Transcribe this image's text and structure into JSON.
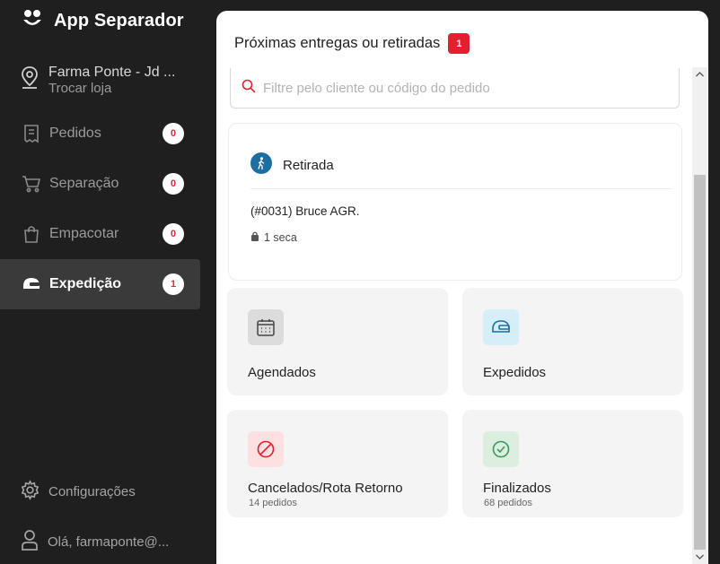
{
  "app": {
    "title": "App Separador"
  },
  "store": {
    "name": "Farma Ponte - Jd ...",
    "switch_label": "Trocar loja"
  },
  "nav": {
    "items": [
      {
        "label": "Pedidos",
        "count": "0"
      },
      {
        "label": "Separação",
        "count": "0"
      },
      {
        "label": "Empacotar",
        "count": "0"
      },
      {
        "label": "Expedição",
        "count": "1",
        "active": true
      }
    ]
  },
  "footer": {
    "settings_label": "Configurações",
    "user_label": "Olá, farmaponte@..."
  },
  "main": {
    "title": "Próximas entregas ou retiradas",
    "count": "1",
    "search_placeholder": "Filtre pelo cliente ou código do pedido",
    "delivery": {
      "type": "Retirada",
      "order": "(#0031) Bruce AGR.",
      "items": "1 seca"
    },
    "tiles": [
      {
        "label": "Agendados",
        "sub": ""
      },
      {
        "label": "Expedidos",
        "sub": ""
      },
      {
        "label": "Cancelados/Rota Retorno",
        "sub": "14 pedidos"
      },
      {
        "label": "Finalizados",
        "sub": "68 pedidos"
      }
    ]
  },
  "colors": {
    "accent_red": "#e2202f",
    "sidebar_bg": "#1f1f1f",
    "active_bg": "#3a3a3a",
    "pickup_blue": "#1c6fa0"
  }
}
